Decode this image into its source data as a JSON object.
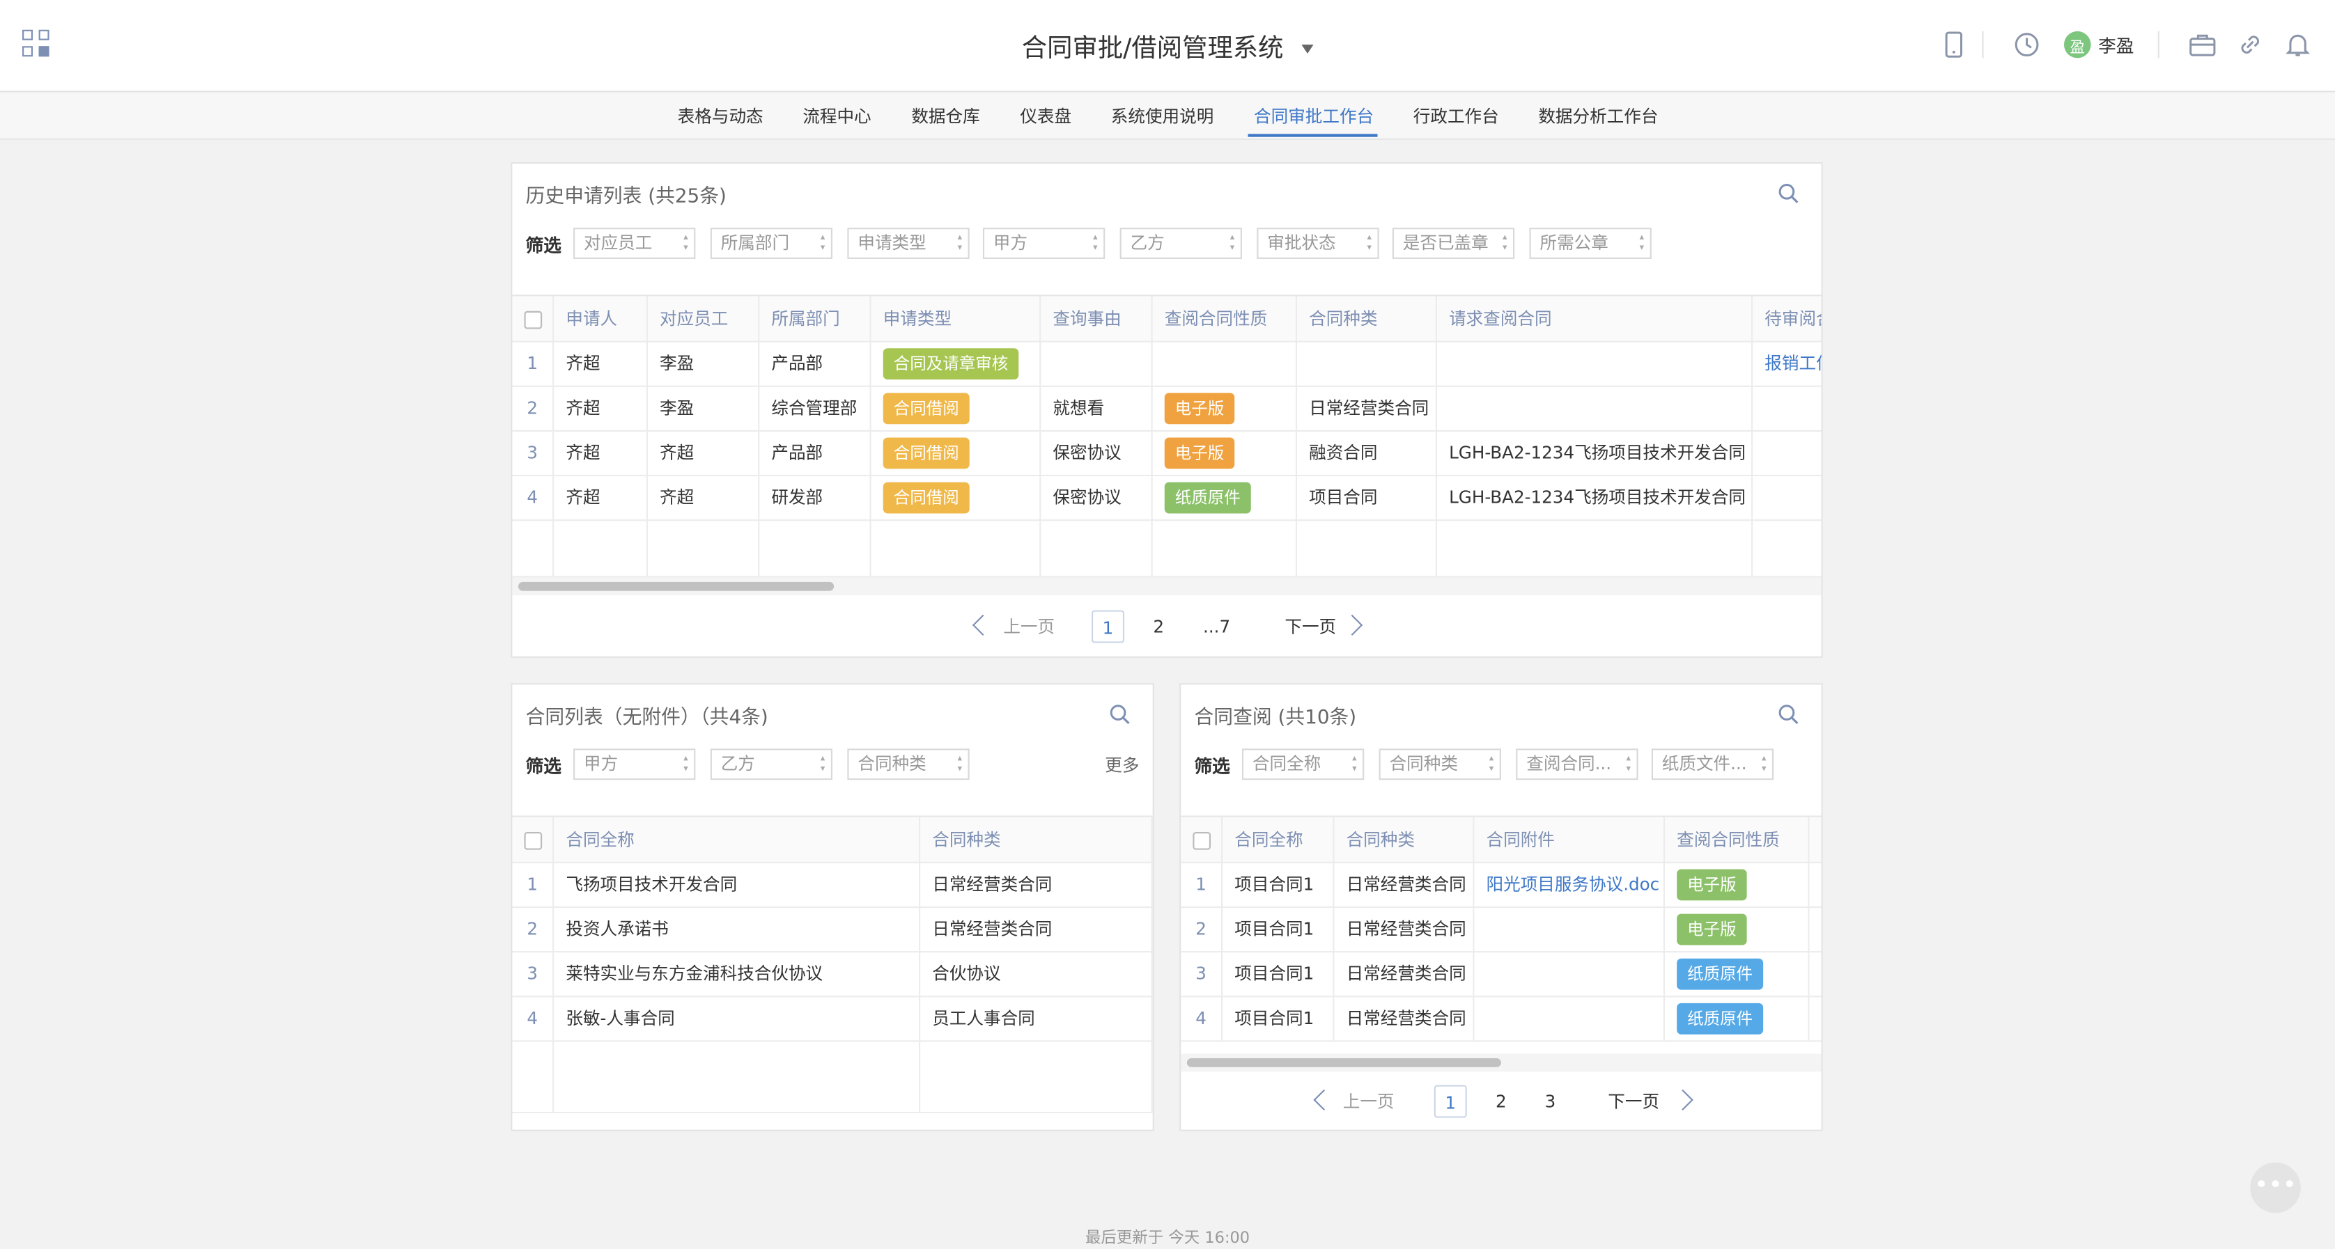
{
  "header": {
    "title": "合同审批/借阅管理系统",
    "user_name": "李盈",
    "user_avatar_text": "盈"
  },
  "nav": {
    "items": [
      "表格与动态",
      "流程中心",
      "数据仓库",
      "仪表盘",
      "系统使用说明",
      "合同审批工作台",
      "行政工作台",
      "数据分析工作台"
    ],
    "active_index": 5
  },
  "history": {
    "title": "历史申请列表 (共25条)",
    "filter_label": "筛选",
    "filters": [
      "对应员工",
      "所属部门",
      "申请类型",
      "甲方",
      "乙方",
      "审批状态",
      "是否已盖章",
      "所需公章"
    ],
    "columns": [
      "申请人",
      "对应员工",
      "所属部门",
      "申请类型",
      "查询事由",
      "查阅合同性质",
      "合同种类",
      "请求查阅合同",
      "待审阅合"
    ],
    "rows": [
      {
        "idx": "1",
        "applicant": "齐超",
        "employee": "李盈",
        "dept": "产品部",
        "type": "合同及请章审核",
        "reason": "",
        "nature": "",
        "kind": "",
        "contract": "",
        "pending": "报销工作"
      },
      {
        "idx": "2",
        "applicant": "齐超",
        "employee": "李盈",
        "dept": "综合管理部",
        "type": "合同借阅",
        "reason": "就想看",
        "nature": "电子版",
        "kind": "日常经营类合同",
        "contract": "",
        "pending": ""
      },
      {
        "idx": "3",
        "applicant": "齐超",
        "employee": "齐超",
        "dept": "产品部",
        "type": "合同借阅",
        "reason": "保密协议",
        "nature": "电子版",
        "kind": "融资合同",
        "contract": "LGH-BA2-1234飞扬项目技术开发合同",
        "pending": ""
      },
      {
        "idx": "4",
        "applicant": "齐超",
        "employee": "齐超",
        "dept": "研发部",
        "type": "合同借阅",
        "reason": "保密协议",
        "nature": "纸质原件",
        "kind": "项目合同",
        "contract": "LGH-BA2-1234飞扬项目技术开发合同",
        "pending": ""
      }
    ],
    "pager": {
      "prev": "上一页",
      "pages": [
        "1",
        "2",
        "...7"
      ],
      "current": "1",
      "next": "下一页"
    }
  },
  "contracts": {
    "title": "合同列表（无附件）（共4条)",
    "filter_label": "筛选",
    "filters": [
      "甲方",
      "乙方",
      "合同种类"
    ],
    "more": "更多",
    "columns": [
      "合同全称",
      "合同种类"
    ],
    "rows": [
      {
        "idx": "1",
        "name": "飞扬项目技术开发合同",
        "kind": "日常经营类合同"
      },
      {
        "idx": "2",
        "name": "投资人承诺书",
        "kind": "日常经营类合同"
      },
      {
        "idx": "3",
        "name": "莱特实业与东方金浦科技合伙协议",
        "kind": "合伙协议"
      },
      {
        "idx": "4",
        "name": "张敏-人事合同",
        "kind": "员工人事合同"
      }
    ]
  },
  "lookup": {
    "title": "合同查阅 (共10条)",
    "filter_label": "筛选",
    "filters": [
      "合同全称",
      "合同种类",
      "查阅合同...",
      "纸质文件..."
    ],
    "columns": [
      "合同全称",
      "合同种类",
      "合同附件",
      "查阅合同性质"
    ],
    "rows": [
      {
        "idx": "1",
        "name": "项目合同1",
        "kind": "日常经营类合同",
        "attachment": "阳光项目服务协议.doc",
        "nature": "电子版"
      },
      {
        "idx": "2",
        "name": "项目合同1",
        "kind": "日常经营类合同",
        "attachment": "",
        "nature": "电子版"
      },
      {
        "idx": "3",
        "name": "项目合同1",
        "kind": "日常经营类合同",
        "attachment": "",
        "nature": "纸质原件"
      },
      {
        "idx": "4",
        "name": "项目合同1",
        "kind": "日常经营类合同",
        "attachment": "",
        "nature": "纸质原件"
      }
    ],
    "pager": {
      "prev": "上一页",
      "pages": [
        "1",
        "2",
        "3"
      ],
      "current": "1",
      "next": "下一页"
    }
  },
  "footer": {
    "text": "最后更新于 今天 16:00"
  },
  "colors": {
    "accent": "#3f78c8",
    "tag_green": "#a6c651",
    "tag_orange": "#f0b849",
    "tag_blue": "#55a9e6"
  }
}
